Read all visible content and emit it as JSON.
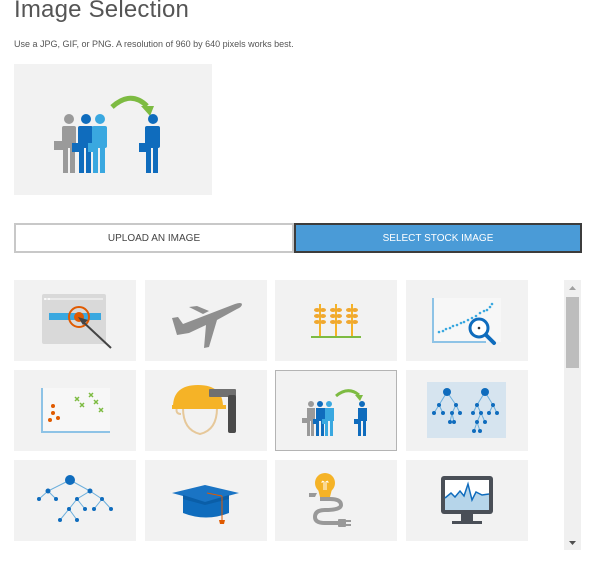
{
  "header": {
    "title": "Image Selection",
    "subtitle": "Use a JPG, GIF, or PNG. A resolution of 960 by 640 pixels works best."
  },
  "preview": {
    "icon": "people-transfer-icon"
  },
  "tabs": [
    {
      "label": "UPLOAD AN IMAGE",
      "active": false
    },
    {
      "label": "SELECT STOCK IMAGE",
      "active": true
    }
  ],
  "colors": {
    "accent": "#4a9bd7",
    "tile_bg": "#f2f2f2",
    "icon_blue": "#0f6cbd",
    "icon_light_blue": "#3aa8e0",
    "icon_gray": "#999999",
    "icon_green": "#7dbb42",
    "icon_orange": "#e05a00",
    "icon_yellow": "#f5b327"
  },
  "stock_images": [
    {
      "icon": "target-click-icon",
      "selected": false
    },
    {
      "icon": "airplane-icon",
      "selected": false
    },
    {
      "icon": "wheat-crops-icon",
      "selected": false
    },
    {
      "icon": "scatter-magnifier-icon",
      "selected": false
    },
    {
      "icon": "cluster-scatter-icon",
      "selected": false
    },
    {
      "icon": "construction-worker-hammer-icon",
      "selected": false
    },
    {
      "icon": "people-transfer-icon",
      "selected": true
    },
    {
      "icon": "decision-forest-icon",
      "selected": false
    },
    {
      "icon": "decision-tree-icon",
      "selected": false
    },
    {
      "icon": "graduation-cap-icon",
      "selected": false
    },
    {
      "icon": "lightbulb-plug-icon",
      "selected": false
    },
    {
      "icon": "monitor-chart-icon",
      "selected": false
    }
  ],
  "scrollbar": {
    "position": 0
  }
}
